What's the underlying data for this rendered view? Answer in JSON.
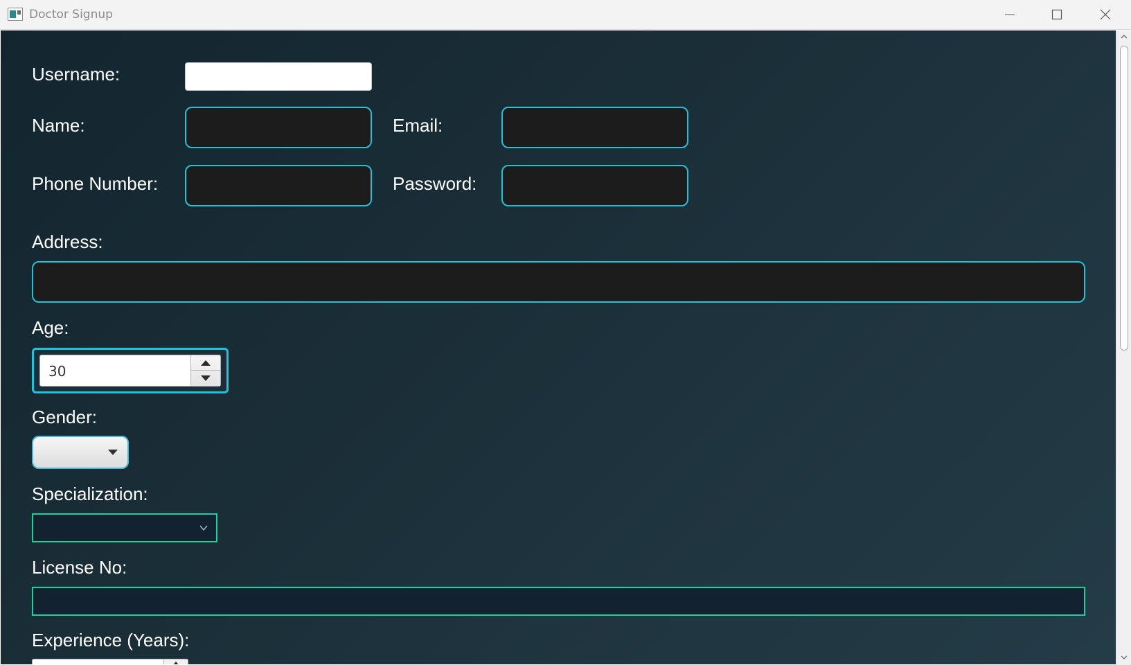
{
  "window": {
    "title": "Doctor Signup",
    "icons": {
      "app": "app-icon",
      "minimize": "minimize-icon",
      "maximize": "maximize-icon",
      "close": "close-icon"
    }
  },
  "form": {
    "username": {
      "label": "Username:",
      "value": ""
    },
    "name": {
      "label": "Name:",
      "value": ""
    },
    "email": {
      "label": "Email:",
      "value": ""
    },
    "phone": {
      "label": "Phone Number:",
      "value": ""
    },
    "password": {
      "label": "Password:",
      "value": ""
    },
    "address": {
      "label": "Address:",
      "value": ""
    },
    "age": {
      "label": "Age:",
      "value": "30"
    },
    "gender": {
      "label": "Gender:",
      "selected": ""
    },
    "specialization": {
      "label": "Specialization:",
      "selected": ""
    },
    "license": {
      "label": "License No:",
      "value": ""
    },
    "experience": {
      "label": "Experience (Years):",
      "value": ""
    }
  },
  "colors": {
    "background_gradient": [
      "#132630",
      "#243c47"
    ],
    "field_border_cyan": "#22c3da",
    "field_border_green": "#1fcf9e",
    "field_fill_dark": "#1c1c1c",
    "label_text": "#ffffff"
  }
}
